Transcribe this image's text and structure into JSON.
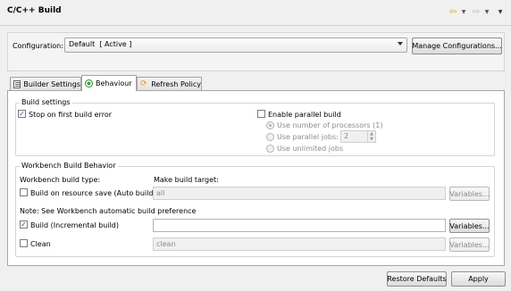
{
  "header": {
    "title": "C/C++ Build"
  },
  "configuration": {
    "label": "Configuration:",
    "selected": "Default  [ Active ]",
    "manage_label": "Manage Configurations..."
  },
  "tabs": [
    {
      "label": "Builder Settings",
      "icon": "builder-settings-icon"
    },
    {
      "label": "Behaviour",
      "icon": "behaviour-icon",
      "active": true
    },
    {
      "label": "Refresh Policy",
      "icon": "refresh-icon"
    }
  ],
  "build_settings": {
    "title": "Build settings",
    "stop_on_error": {
      "label": "Stop on first build error",
      "checked": true
    },
    "parallel": {
      "label": "Enable parallel build",
      "checked": false
    },
    "radios": [
      {
        "label": "Use number of processors (1)",
        "selected": true
      },
      {
        "label": "Use parallel jobs:",
        "selected": false
      },
      {
        "label": "Use unlimited jobs",
        "selected": false
      }
    ],
    "jobs_value": "2"
  },
  "workbench": {
    "title": "Workbench Build Behavior",
    "col_type": "Workbench build type:",
    "col_target": "Make build target:",
    "note": "Note: See Workbench automatic build preference",
    "variables_label": "Variables...",
    "rows": [
      {
        "label": "Build on resource save (Auto build)",
        "checked": false,
        "value": "all",
        "enabled": false
      },
      {
        "label": "Build (Incremental build)",
        "checked": true,
        "value": "",
        "enabled": true
      },
      {
        "label": "Clean",
        "checked": false,
        "value": "clean",
        "enabled": false
      }
    ]
  },
  "footer": {
    "restore_label": "Restore Defaults",
    "apply_label": "Apply"
  },
  "colors": {
    "accent": "#1d4f9b",
    "panel_bg": "#f0f0f0",
    "nav_back": "#e0a020"
  }
}
